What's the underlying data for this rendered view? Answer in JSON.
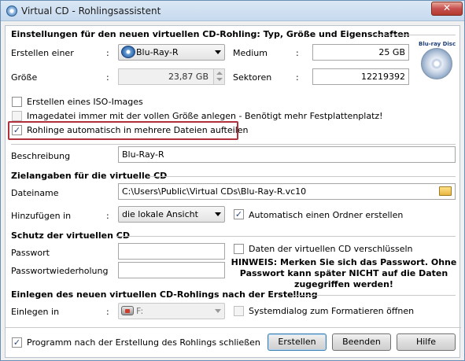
{
  "window": {
    "title": "Virtual CD - Rohlingsassistent",
    "close_glyph": "✕"
  },
  "settings": {
    "heading": "Einstellungen für den neuen virtuellen CD-Rohling: Typ, Größe und Eigenschaften",
    "create_label": "Erstellen einer",
    "create_value": "Blu-Ray-R",
    "medium_label": "Medium",
    "medium_value": "25 GB",
    "size_label": "Größe",
    "size_value": "23,87 GB",
    "sectors_label": "Sektoren",
    "sectors_value": "12219392",
    "colon": ":",
    "bd_logo_text": "Blu-ray Disc",
    "iso_label": "Erstellen eines ISO-Images",
    "iso_checked": false,
    "fullsize_label": "Imagedatei immer mit der vollen Größe anlegen - Benötigt mehr Festplattenplatz!",
    "fullsize_checked": false,
    "split_label": "Rohlinge automatisch in mehrere Dateien aufteilen",
    "split_checked": true,
    "description_label": "Beschreibung",
    "description_value": "Blu-Ray-R"
  },
  "target": {
    "heading": "Zielangaben für die virtuelle CD",
    "filename_label": "Dateiname",
    "filename_value": "C:\\Users\\Public\\Virtual CDs\\Blu-Ray-R.vc10",
    "add_label": "Hinzufügen in",
    "add_value": "die lokale Ansicht",
    "auto_folder_label": "Automatisch einen Ordner erstellen",
    "auto_folder_checked": true
  },
  "protection": {
    "heading": "Schutz der virtuellen CD",
    "password_label": "Passwort",
    "password_repeat_label": "Passwortwiederholung",
    "encrypt_label": "Daten der virtuellen CD verschlüsseln",
    "encrypt_checked": false,
    "hint_line1": "HINWEIS: Merken Sie sich das Passwort. Ohne",
    "hint_line2": "Passwort kann später NICHT auf die Daten",
    "hint_line3": "zugegriffen werden!"
  },
  "insert": {
    "heading": "Einlegen des neuen virtuellen CD-Rohlings nach der Erstellung",
    "insert_label": "Einlegen in",
    "insert_value": "F:",
    "format_label": "Systemdialog zum Formatieren öffnen",
    "format_checked": false
  },
  "footer": {
    "close_after_label": "Programm nach der Erstellung des Rohlings schließen",
    "close_after_checked": true,
    "create_button": "Erstellen",
    "exit_button": "Beenden",
    "help_button": "Hilfe"
  },
  "colors": {
    "highlight_border": "#b0313c",
    "titlebar": "#c6d9ee"
  }
}
